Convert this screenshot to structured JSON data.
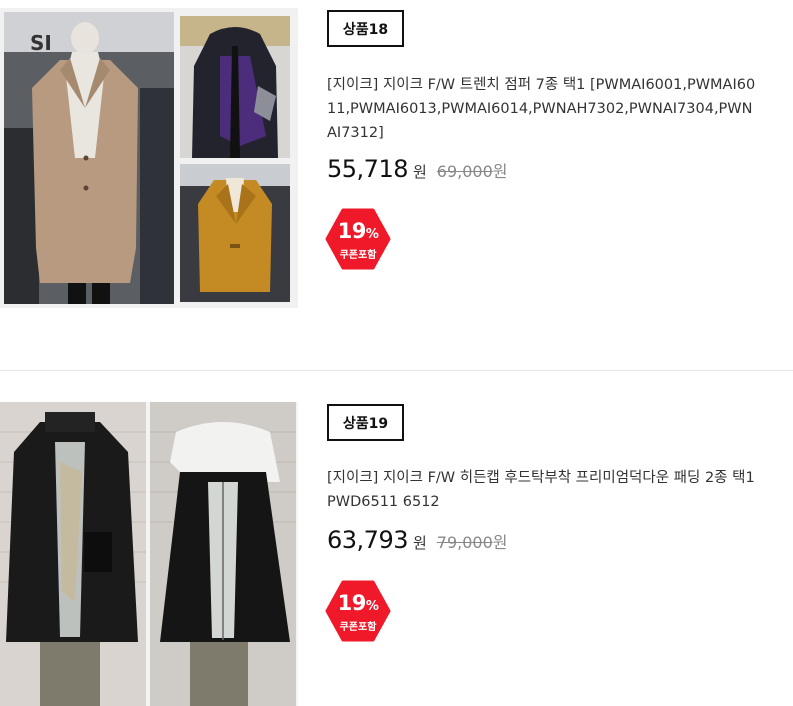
{
  "products": [
    {
      "badge": "상품18",
      "title": "[지이크] 지이크 F/W 트렌치 점퍼 7종 택1 [PWMAI6001,PWMAI6011,PWMAI6013,PWMAI6014,PWNAH7302,PWNAI7304,PWNAI7312]",
      "price": "55,718",
      "currency": "원",
      "original_price": "69,000",
      "original_currency": "원",
      "discount_percent": "19",
      "discount_symbol": "%",
      "coupon_label": "쿠폰포함",
      "badge_color": "#f0192a",
      "images": [
        "beige-long-coat-photo",
        "navy-purple-hooded-jacket-photo",
        "mustard-trench-coat-photo"
      ]
    },
    {
      "badge": "상품19",
      "title": "[지이크] 지이크 F/W 히든캡 후드탁부착 프리미엄덕다운 패딩 2종 택1 PWD6511 6512",
      "price": "63,793",
      "currency": "원",
      "original_price": "79,000",
      "original_currency": "원",
      "discount_percent": "19",
      "discount_symbol": "%",
      "coupon_label": "쿠폰포함",
      "badge_color": "#f0192a",
      "images": [
        "black-padded-jacket-photo",
        "black-hooded-down-jacket-photo"
      ]
    }
  ]
}
